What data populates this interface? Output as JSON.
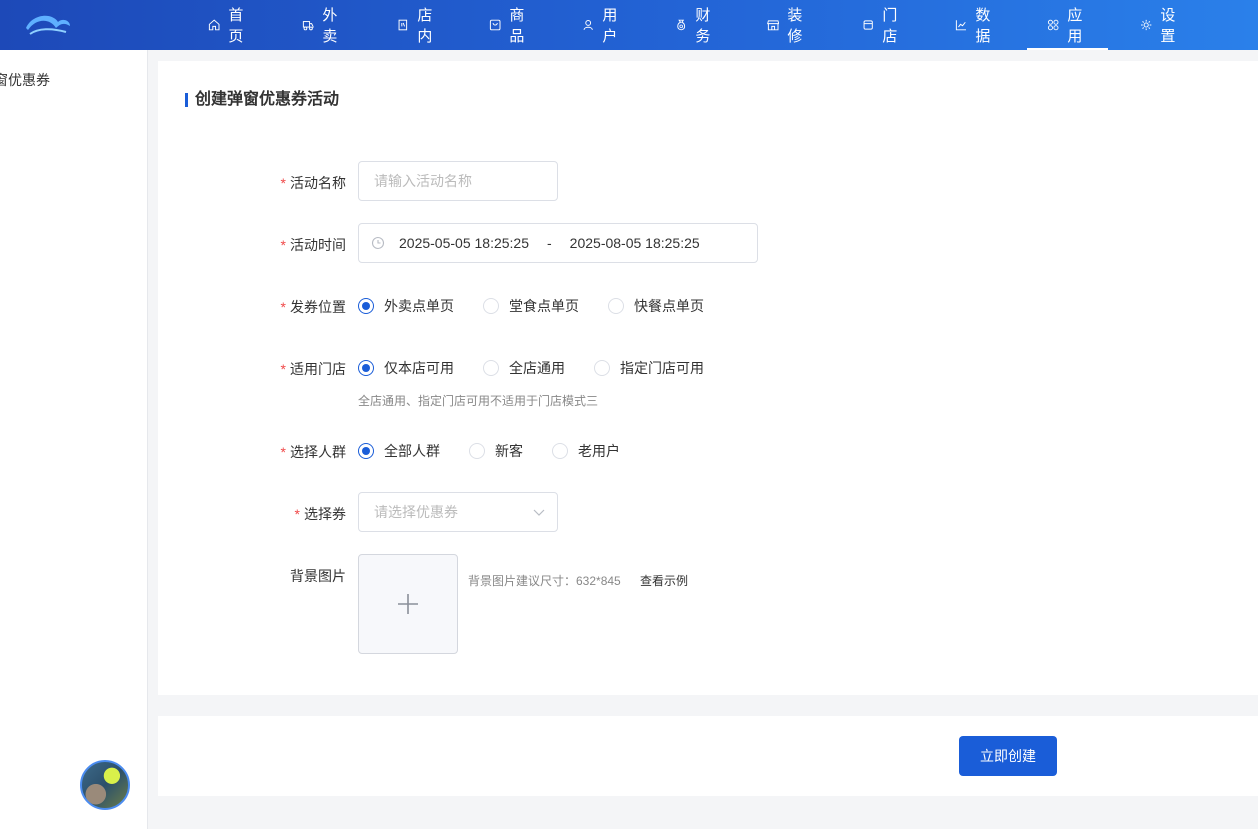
{
  "nav": {
    "items": [
      {
        "label": "首页",
        "icon": "home-icon"
      },
      {
        "label": "外卖",
        "icon": "delivery-icon"
      },
      {
        "label": "店内",
        "icon": "dine-in-icon"
      },
      {
        "label": "商品",
        "icon": "goods-icon"
      },
      {
        "label": "用户",
        "icon": "user-icon"
      },
      {
        "label": "财务",
        "icon": "money-bag-icon"
      },
      {
        "label": "装修",
        "icon": "storefront-icon"
      },
      {
        "label": "门店",
        "icon": "shop-icon"
      },
      {
        "label": "数据",
        "icon": "chart-icon"
      },
      {
        "label": "应用",
        "icon": "apps-grid-icon"
      },
      {
        "label": "设置",
        "icon": "gear-icon"
      }
    ],
    "active": "应用"
  },
  "sidebar": {
    "item_label": "窗优惠券"
  },
  "card": {
    "title": "创建弹窗优惠券活动"
  },
  "form": {
    "activity_name": {
      "label": "活动名称",
      "placeholder": "请输入活动名称"
    },
    "activity_time": {
      "label": "活动时间",
      "start": "2025-05-05 18:25:25",
      "separator": "-",
      "end": "2025-08-05 18:25:25"
    },
    "coupon_position": {
      "label": "发券位置",
      "options": [
        "外卖点单页",
        "堂食点单页",
        "快餐点单页"
      ],
      "selected": "外卖点单页"
    },
    "store_scope": {
      "label": "适用门店",
      "options": [
        "仅本店可用",
        "全店通用",
        "指定门店可用"
      ],
      "selected": "仅本店可用",
      "hint": "全店通用、指定门店可用不适用于门店模式三"
    },
    "audience": {
      "label": "选择人群",
      "options": [
        "全部人群",
        "新客",
        "老用户"
      ],
      "selected": "全部人群"
    },
    "coupon": {
      "label": "选择券",
      "placeholder": "请选择优惠券"
    },
    "background": {
      "label": "背景图片",
      "hint": "背景图片建议尺寸：632*845",
      "example_link": "查看示例"
    }
  },
  "footer": {
    "submit_label": "立即创建"
  },
  "colors": {
    "primary": "#1a5dd8",
    "required": "#f04848",
    "nav_start": "#1d49b8",
    "nav_end": "#2a80ea"
  }
}
